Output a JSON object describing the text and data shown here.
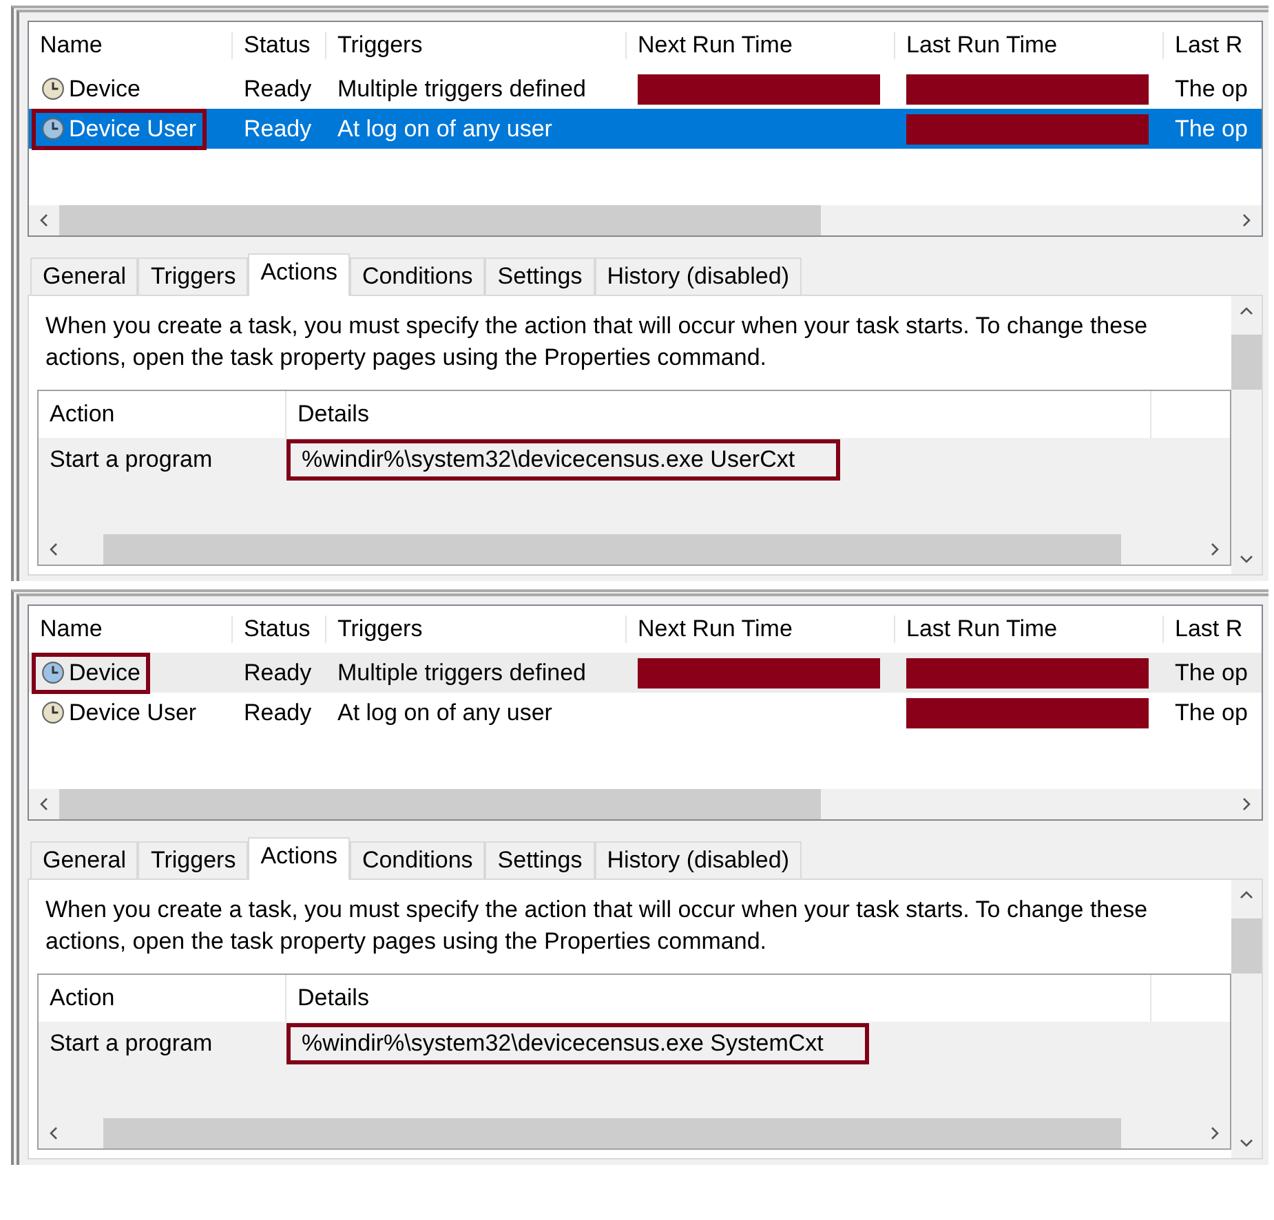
{
  "panels": [
    {
      "focused": true,
      "task_list": {
        "columns": [
          "Name",
          "Status",
          "Triggers",
          "Next Run Time",
          "Last Run Time",
          "Last R"
        ],
        "rows": [
          {
            "name": "Device",
            "status": "Ready",
            "triggers": "Multiple triggers defined",
            "next_run_redacted": true,
            "last_run_redacted": true,
            "last_result": "The op",
            "selected": false,
            "outlined": false
          },
          {
            "name": "Device User",
            "status": "Ready",
            "triggers": "At log on of any user",
            "next_run_redacted": false,
            "last_run_redacted": true,
            "last_result": "The op",
            "selected": true,
            "outlined": true
          }
        ]
      },
      "details": {
        "tabs": [
          {
            "label": "General",
            "selected": false
          },
          {
            "label": "Triggers",
            "selected": false
          },
          {
            "label": "Actions",
            "selected": true
          },
          {
            "label": "Conditions",
            "selected": false
          },
          {
            "label": "Settings",
            "selected": false
          },
          {
            "label": "History (disabled)",
            "selected": false
          }
        ],
        "description": "When you create a task, you must specify the action that will occur when your task starts.  To change these actions, open the task property pages using the Properties command.",
        "columns": [
          "Action",
          "Details"
        ],
        "rows": [
          {
            "action": "Start a program",
            "details": "%windir%\\system32\\devicecensus.exe UserCxt",
            "outlined": true
          }
        ]
      }
    },
    {
      "focused": false,
      "task_list": {
        "columns": [
          "Name",
          "Status",
          "Triggers",
          "Next Run Time",
          "Last Run Time",
          "Last R"
        ],
        "rows": [
          {
            "name": "Device",
            "status": "Ready",
            "triggers": "Multiple triggers defined",
            "next_run_redacted": true,
            "last_run_redacted": true,
            "last_result": "The op",
            "selected": true,
            "outlined": true
          },
          {
            "name": "Device User",
            "status": "Ready",
            "triggers": "At log on of any user",
            "next_run_redacted": false,
            "last_run_redacted": true,
            "last_result": "The op",
            "selected": false,
            "outlined": false
          }
        ]
      },
      "details": {
        "tabs": [
          {
            "label": "General",
            "selected": false
          },
          {
            "label": "Triggers",
            "selected": false
          },
          {
            "label": "Actions",
            "selected": true
          },
          {
            "label": "Conditions",
            "selected": false
          },
          {
            "label": "Settings",
            "selected": false
          },
          {
            "label": "History (disabled)",
            "selected": false
          }
        ],
        "description": "When you create a task, you must specify the action that will occur when your task starts.  To change these actions, open the task property pages using the Properties command.",
        "columns": [
          "Action",
          "Details"
        ],
        "rows": [
          {
            "action": "Start a program",
            "details": "%windir%\\system32\\devicecensus.exe SystemCxt",
            "outlined": true
          }
        ]
      }
    }
  ]
}
